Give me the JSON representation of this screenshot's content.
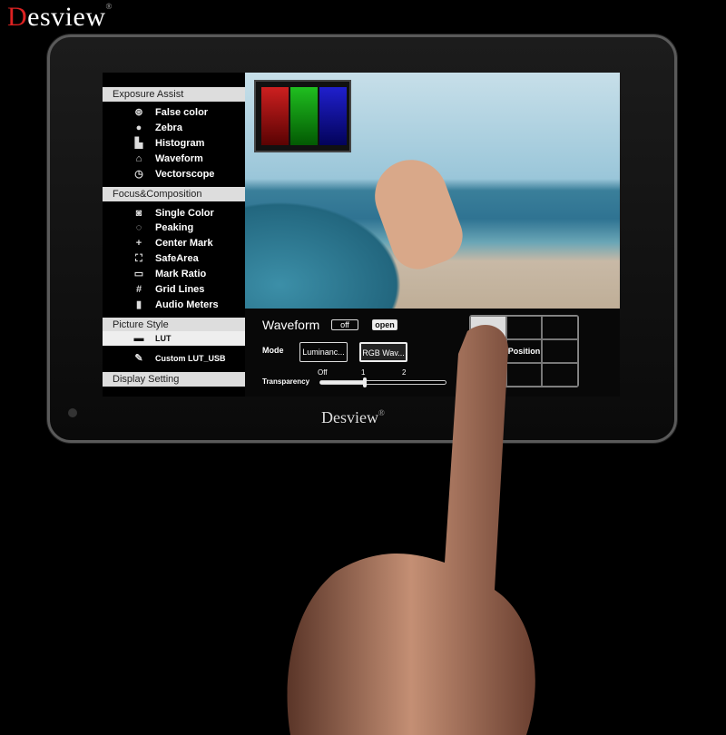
{
  "brand": {
    "logo_text": "Desview",
    "reg_mark": "®",
    "bezel_logo": "Desview"
  },
  "sidebar": {
    "sections": [
      {
        "title": "Exposure Assist",
        "items": [
          {
            "label": "False color",
            "icon": "false-color-icon"
          },
          {
            "label": "Zebra",
            "icon": "zebra-icon"
          },
          {
            "label": "Histogram",
            "icon": "histogram-icon"
          },
          {
            "label": "Waveform",
            "icon": "waveform-icon"
          },
          {
            "label": "Vectorscope",
            "icon": "vectorscope-icon"
          }
        ]
      },
      {
        "title": "Focus&Composition",
        "items": [
          {
            "label": "Single Color",
            "icon": "single-color-icon"
          },
          {
            "label": "Peaking",
            "icon": "peaking-icon"
          },
          {
            "label": "Center Mark",
            "icon": "center-mark-icon"
          },
          {
            "label": "SafeArea",
            "icon": "safe-area-icon"
          },
          {
            "label": "Mark Ratio",
            "icon": "mark-ratio-icon"
          },
          {
            "label": "Grid Lines",
            "icon": "grid-lines-icon"
          },
          {
            "label": "Audio Meters",
            "icon": "audio-meters-icon"
          }
        ]
      },
      {
        "title": "Picture Style",
        "items": [
          {
            "label": "LUT",
            "icon": "lut-icon",
            "selected": true
          },
          {
            "label": "Custom LUT_USB",
            "icon": "edit-icon"
          }
        ]
      },
      {
        "title": "Display Setting",
        "items": []
      }
    ]
  },
  "panel": {
    "title": "Waveform",
    "off_label": "off",
    "open_label": "open",
    "state": "open",
    "mode_label": "Mode",
    "modes": [
      "Luminanc...",
      "RGB Wav..."
    ],
    "selected_mode": "RGB Wav...",
    "transparency_label": "Transparency",
    "transparency_ticks": [
      "Off",
      "1",
      "2"
    ],
    "transparency_value": "1",
    "position_label": "Position",
    "position_selected": "top-left"
  },
  "colors": {
    "header_bg": "#dddddd",
    "selected_bg": "#eeeeee"
  }
}
